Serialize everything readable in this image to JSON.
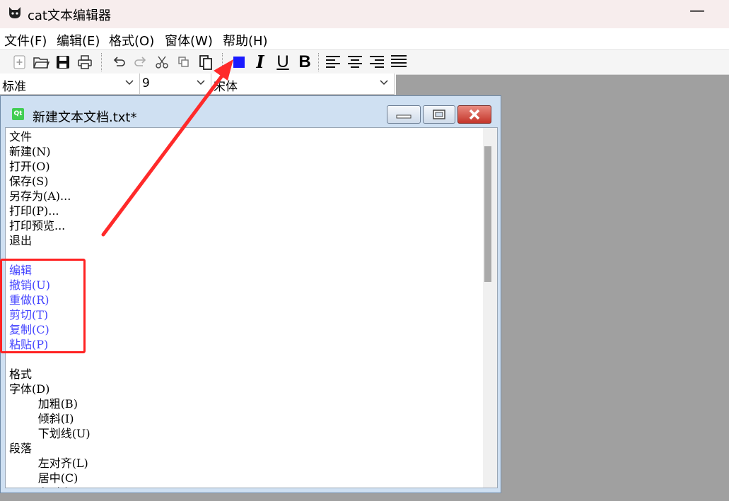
{
  "app": {
    "title": "cat文本编辑器",
    "minimize_glyph": "—"
  },
  "menubar": {
    "items": [
      "文件(F)",
      "编辑(E)",
      "格式(O)",
      "窗体(W)",
      "帮助(H)"
    ]
  },
  "toolbar": {
    "icons": [
      "new-file-icon",
      "open-folder-icon",
      "save-icon",
      "print-icon",
      "undo-icon",
      "redo-icon",
      "cut-icon",
      "copy-icon",
      "paste-icon",
      "color-icon",
      "italic-icon",
      "underline-icon",
      "bold-icon",
      "align-left-icon",
      "align-center-icon",
      "align-right-icon",
      "justify-icon"
    ],
    "italic_label": "I",
    "underline_label": "U",
    "bold_label": "B",
    "color_swatch": "#1a1aff"
  },
  "fontbar": {
    "style_value": "标准",
    "size_value": "9",
    "font_value": "宋体"
  },
  "child_window": {
    "title": "新建文本文档.txt*"
  },
  "editor": {
    "lines": [
      "文件",
      "新建(N)",
      "打开(O)",
      "保存(S)",
      "另存为(A)...",
      "打印(P)...",
      "打印预览...",
      "退出",
      "",
      "编辑",
      "撤销(U)",
      "重做(R)",
      "剪切(T)",
      "复制(C)",
      "粘贴(P)",
      "",
      "格式",
      "字体(D)",
      "        加粗(B)",
      "        倾斜(I)",
      "        下划线(U)",
      "段落",
      "        左对齐(L)",
      "        居中(C)",
      "        右对齐(R)"
    ],
    "highlight_lines": [
      9,
      10,
      11,
      12,
      13,
      14
    ],
    "text_color": "#4545ff"
  },
  "annotation": {
    "color": "#ff2222"
  }
}
